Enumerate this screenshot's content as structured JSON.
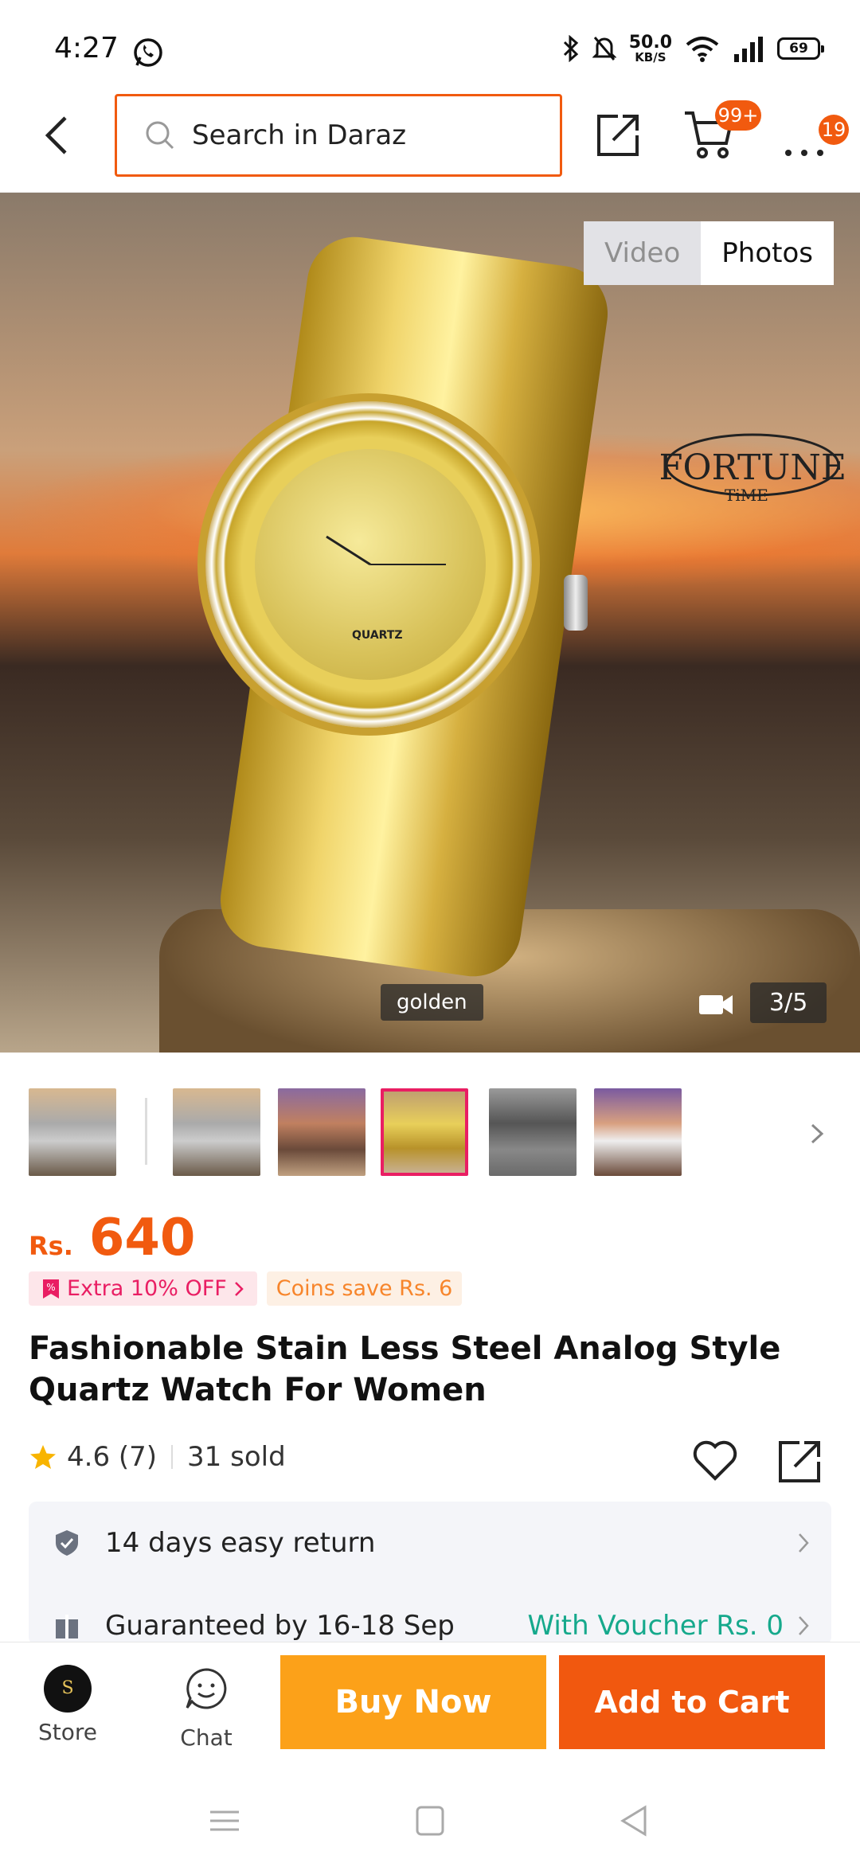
{
  "status_bar": {
    "time": "4:27",
    "net_speed_value": "50.0",
    "net_speed_unit": "KB/S",
    "battery": "69",
    "icons": [
      "whatsapp-icon",
      "bluetooth-icon",
      "mute-icon",
      "wifi-icon",
      "signal-icon",
      "battery-icon"
    ]
  },
  "header": {
    "search_placeholder": "Search in Daraz",
    "cart_badge": "99+",
    "more_badge": "19"
  },
  "gallery": {
    "tabs": [
      {
        "label": "Video",
        "active": false
      },
      {
        "label": "Photos",
        "active": true
      }
    ],
    "brand_logo_text": "FORTUNE",
    "brand_logo_sub": "TiME",
    "dial_text": "QUARTZ",
    "variant_label": "golden",
    "counter": "3/5",
    "thumbnails": [
      {
        "variant": "silver",
        "selected": false
      },
      {
        "variant": "silver",
        "selected": false
      },
      {
        "variant": "rose",
        "selected": false
      },
      {
        "variant": "golden",
        "selected": true
      },
      {
        "variant": "black",
        "selected": false
      },
      {
        "variant": "rose-white",
        "selected": false
      }
    ]
  },
  "product": {
    "currency": "Rs.",
    "price": "640",
    "promo_discount": "Extra 10% OFF",
    "promo_coins": "Coins save Rs. 6",
    "title": "Fashionable Stain Less Steel Analog Style Quartz Watch For Women",
    "rating": "4.6 (7)",
    "sold": "31 sold"
  },
  "info": {
    "return_label": "14 days easy return",
    "delivery_label": "Guaranteed by 16-18 Sep",
    "voucher_label": "With Voucher Rs. 0"
  },
  "bottom_bar": {
    "store_label": "Store",
    "store_logo_text": "S",
    "chat_label": "Chat",
    "buy_now": "Buy Now",
    "add_to_cart": "Add to Cart"
  },
  "colors": {
    "accent": "#f15a0f",
    "buy_now": "#fca119",
    "promo_pink": "#e91e63",
    "voucher_green": "#16a98c"
  }
}
